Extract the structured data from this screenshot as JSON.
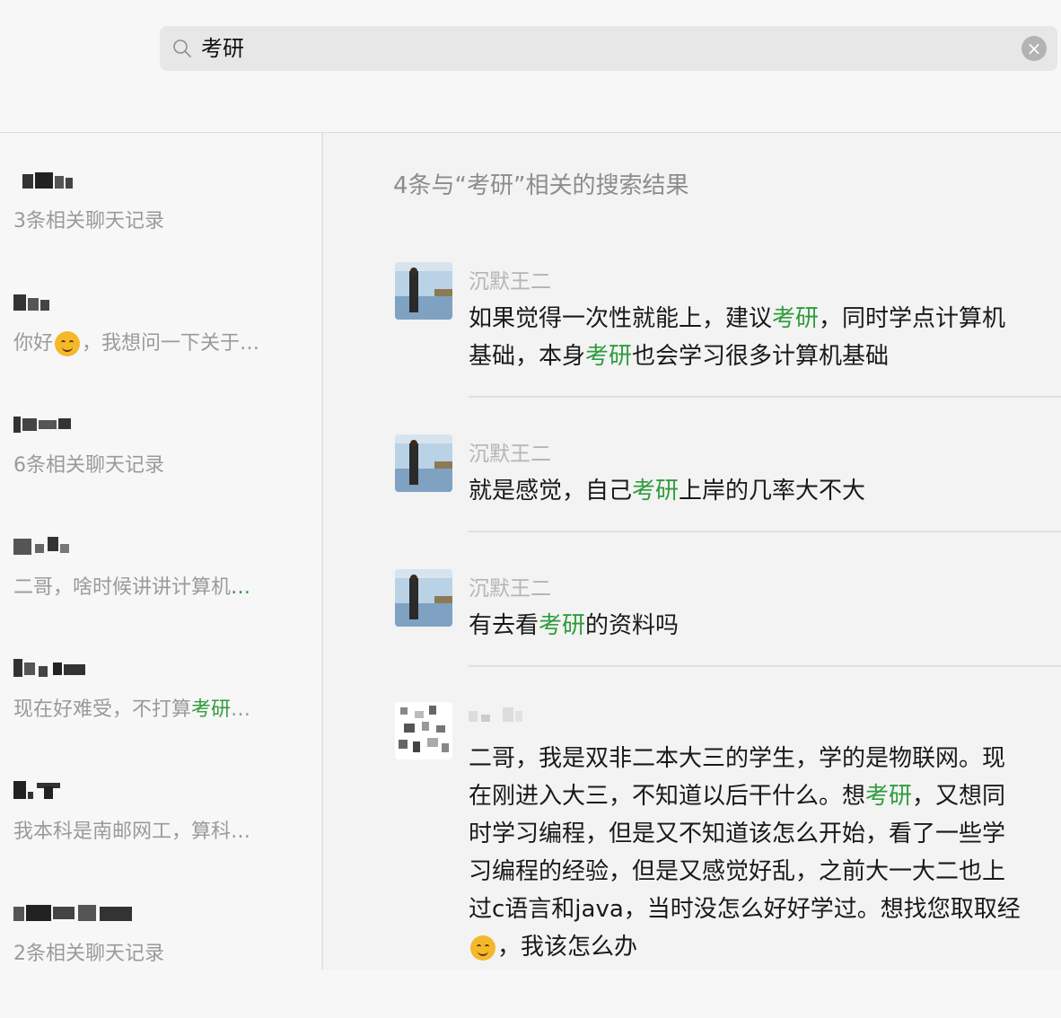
{
  "search": {
    "value": "考研",
    "clear_icon": "close-icon"
  },
  "contacts": [
    {
      "sub": "3条相关聊天记录"
    },
    {
      "sub_parts": [
        "你好",
        "，我想问一下关于…"
      ]
    },
    {
      "sub": "6条相关聊天记录"
    },
    {
      "sub_parts": [
        "二哥，啥时候讲讲计算机",
        "…"
      ]
    },
    {
      "sub_parts": [
        "现在好难受，不打算",
        "考研",
        "…"
      ]
    },
    {
      "sub": "我本科是南邮网工，算科…"
    },
    {
      "sub": "2条相关聊天记录"
    }
  ],
  "results": {
    "title": "4条与“考研”相关的搜索结果",
    "items": [
      {
        "sender": "沉默王二",
        "parts": [
          "如果觉得一次性就能上，建议",
          "考研",
          "，同时学点计算机基础，本身",
          "考研",
          "也会学习很多计算机基础"
        ]
      },
      {
        "sender": "沉默王二",
        "parts": [
          "就是感觉，自己",
          "考研",
          "上岸的几率大不大"
        ]
      },
      {
        "sender": "沉默王二",
        "parts": [
          "有去看",
          "考研",
          "的资料吗"
        ]
      },
      {
        "sender": "",
        "parts": [
          "二哥，我是双非二本大三的学生，学的是物联网。现在刚进入大三，不知道以后干什么。想",
          "考研",
          "，又想同时学习编程，但是又不知道该怎么开始，看了一些学习编程的经验，但是又感觉好乱，之前大一大二也上过c语言和java，当时没怎么好好学过。想找您取取经",
          "，我该怎么办"
        ]
      }
    ]
  },
  "colors": {
    "highlight": "#2e9c3c",
    "muted": "#9a9a9a"
  }
}
